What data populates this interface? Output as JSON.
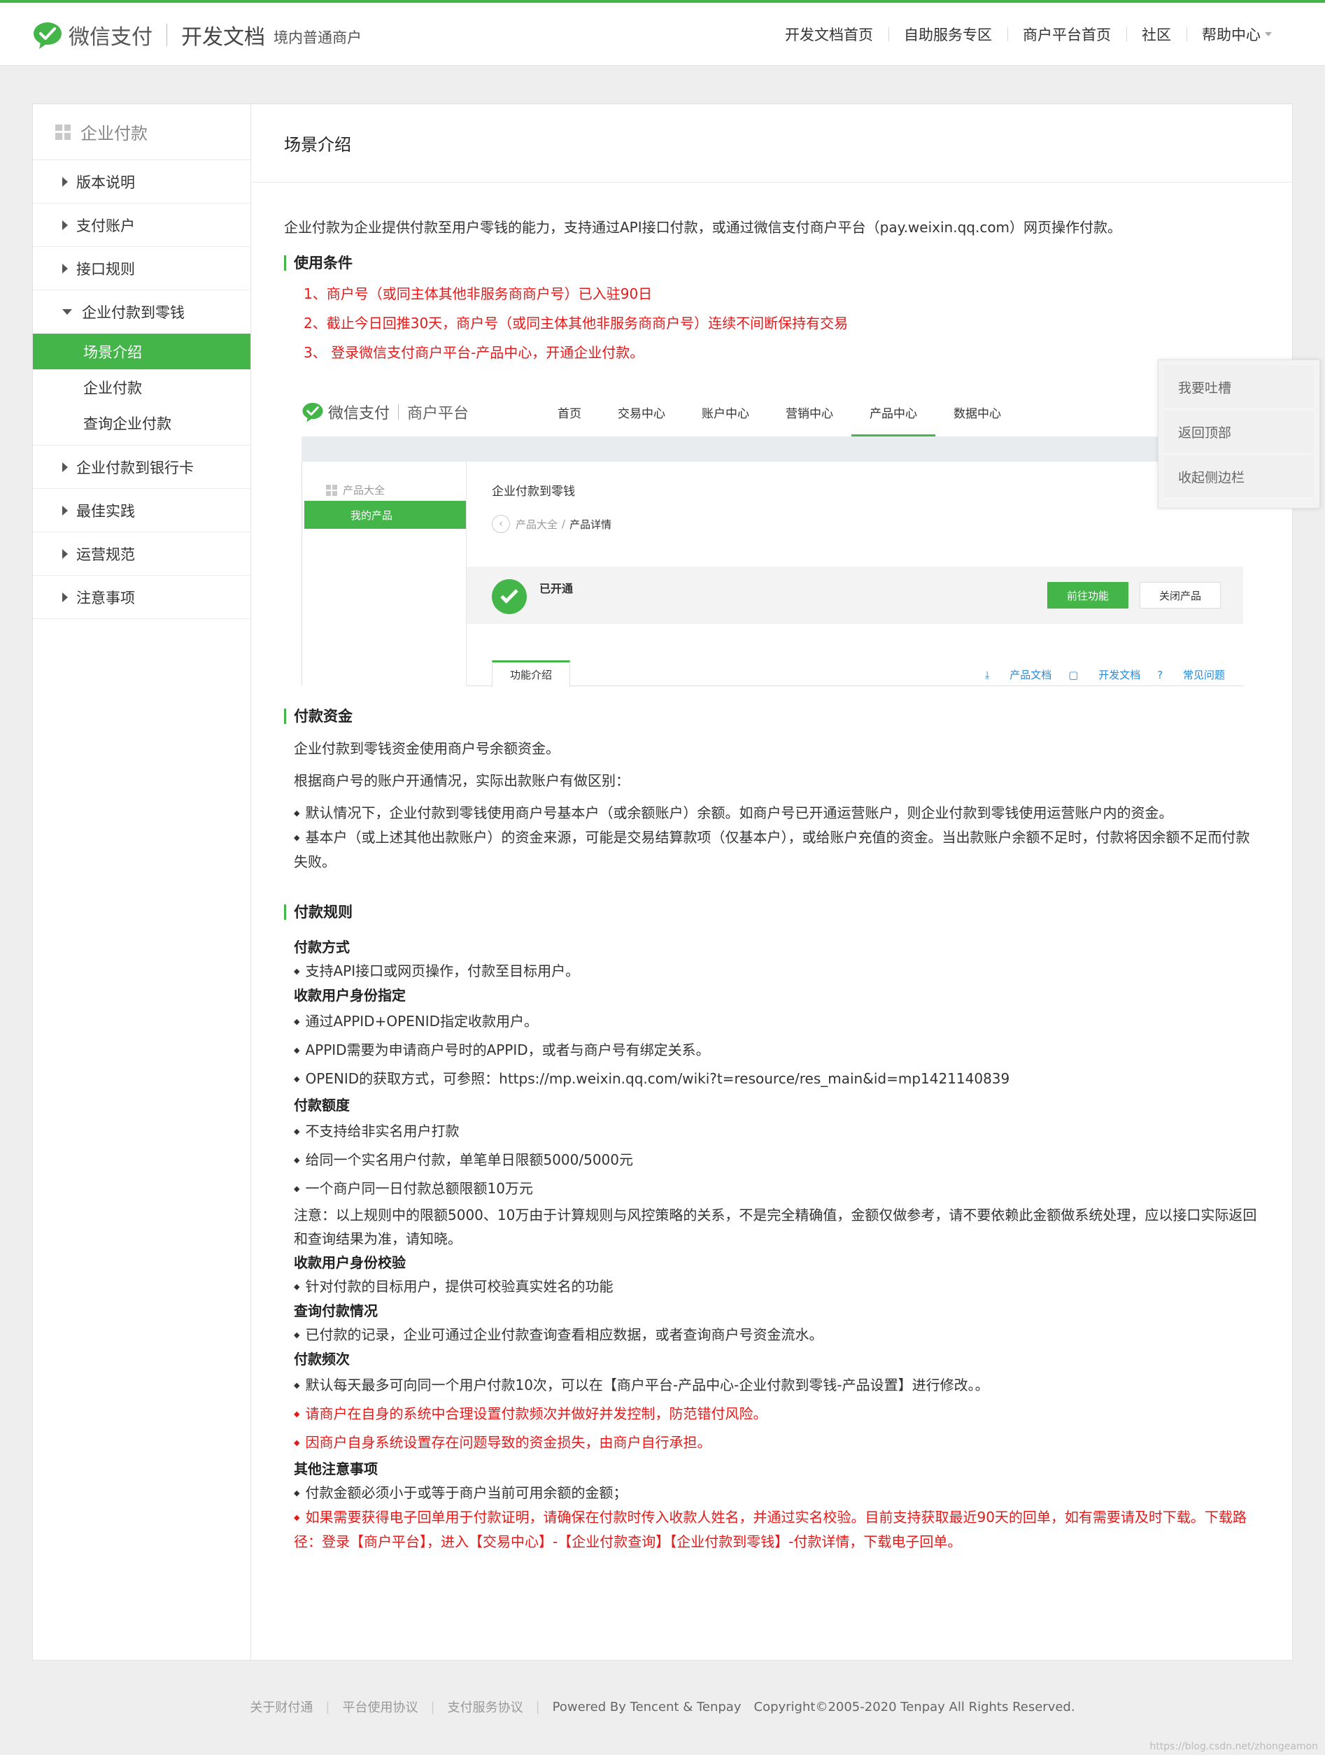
{
  "header": {
    "brand_name": "微信支付",
    "doc_title": "开发文档",
    "doc_sub": "境内普通商户",
    "nav": [
      "开发文档首页",
      "自助服务专区",
      "商户平台首页",
      "社区",
      "帮助中心"
    ],
    "accent": "#44b549"
  },
  "sidebar": {
    "title": "企业付款",
    "items": {
      "version": "版本说明",
      "account": "支付账户",
      "api_rules": "接口规则",
      "to_change": "企业付款到零钱",
      "scene": "场景介绍",
      "pay": "企业付款",
      "query": "查询企业付款",
      "to_bank": "企业付款到银行卡",
      "best": "最佳实践",
      "ops": "运营规范",
      "notes": "注意事项"
    }
  },
  "content": {
    "page_title": "场景介绍",
    "intro": "企业付款为企业提供付款至用户零钱的能力，支持通过API接口付款，或通过微信支付商户平台（pay.weixin.qq.com）网页操作付款。",
    "conditions_title": "使用条件",
    "conditions": [
      "1、商户号（或同主体其他非服务商商户号）已入驻90日",
      "2、截止今日回推30天，商户号（或同主体其他非服务商商户号）连续不间断保持有交易",
      "3、 登录微信支付商户平台-产品中心，开通企业付款。"
    ],
    "funds_title": "付款资金",
    "funds_p1": "企业付款到零钱资金使用商户号余额资金。",
    "funds_p2": "根据商户号的账户开通情况，实际出款账户有做区别：",
    "funds_b1": "默认情况下，企业付款到零钱使用商户号基本户（或余额账户）余额。如商户号已开通运营账户，则企业付款到零钱使用运营账户内的资金。",
    "funds_b2": "基本户（或上述其他出款账户）的资金来源，可能是交易结算款项（仅基本户），或给账户充值的资金。当出款账户余额不足时，付款将因余额不足而付款失败。",
    "rules_title": "付款规则",
    "method_title": "付款方式",
    "method_b1": "支持API接口或网页操作，付款至目标用户。",
    "identity_title": "收款用户身份指定",
    "identity_b1": "通过APPID+OPENID指定收款用户。",
    "identity_b2": "APPID需要为申请商户号时的APPID，或者与商户号有绑定关系。",
    "identity_b3": "OPENID的获取方式，可参照：https://mp.weixin.qq.com/wiki?t=resource/res_main&id=mp1421140839",
    "amount_title": "付款额度",
    "amount_b1": "不支持给非实名用户打款",
    "amount_b2": "给同一个实名用户付款，单笔单日限额5000/5000元",
    "amount_b3": "一个商户同一日付款总额限额10万元",
    "amount_note": "注意：以上规则中的限额5000、10万由于计算规则与风控策略的关系，不是完全精确值，金额仅做参考，请不要依赖此金额做系统处理，应以接口实际返回和查询结果为准，请知晓。",
    "verify_title": "收款用户身份校验",
    "verify_b1": "针对付款的目标用户，提供可校验真实姓名的功能",
    "query_title": "查询付款情况",
    "query_b1": "已付款的记录，企业可通过企业付款查询查看相应数据，或者查询商户号资金流水。",
    "freq_title": "付款频次",
    "freq_b1": "默认每天最多可向同一个用户付款10次，可以在【商户平台-产品中心-企业付款到零钱-产品设置】进行修改。。",
    "freq_b2": "请商户在自身的系统中合理设置付款频次并做好并发控制，防范错付风险。",
    "freq_b3": "因商户自身系统设置存在问题导致的资金损失，由商户自行承担。",
    "other_title": "其他注意事项",
    "other_b1": "付款金额必须小于或等于商户当前可用余额的金额；",
    "other_b2": "如果需要获得电子回单用于付款证明，请确保在付款时传入收款人姓名，并通过实名校验。目前支持获取最近90天的回单，如有需要请及时下载。下载路径：登录【商户平台】，进入【交易中心】-【企业付款查询】【企业付款到零钱】-付款详情，下载电子回单。"
  },
  "screenshot": {
    "brand_name": "微信支付",
    "platform": "商户平台",
    "tabs": [
      "首页",
      "交易中心",
      "账户中心",
      "营销中心",
      "产品中心",
      "数据中心"
    ],
    "active_tab": "产品中心",
    "left_title": "产品大全",
    "left_active": "我的产品",
    "right_title": "企业付款到零钱",
    "crumb_parent": "产品大全",
    "crumb_sep": "/",
    "crumb_current": "产品详情",
    "status": "已开通",
    "btn_go": "前往功能",
    "btn_close": "关闭产品",
    "subtab": "功能介绍",
    "links": [
      "产品文档",
      "开发文档",
      "常见问题"
    ]
  },
  "float_panel": [
    "我要吐槽",
    "返回顶部",
    "收起侧边栏"
  ],
  "footer": {
    "links": [
      "关于财付通",
      "平台使用协议",
      "支付服务协议"
    ],
    "powered": "Powered By Tencent & Tenpay",
    "copyright": "Copyright©2005-2020 Tenpay All Rights Reserved."
  },
  "watermark": "https://blog.csdn.net/zhongeamon"
}
